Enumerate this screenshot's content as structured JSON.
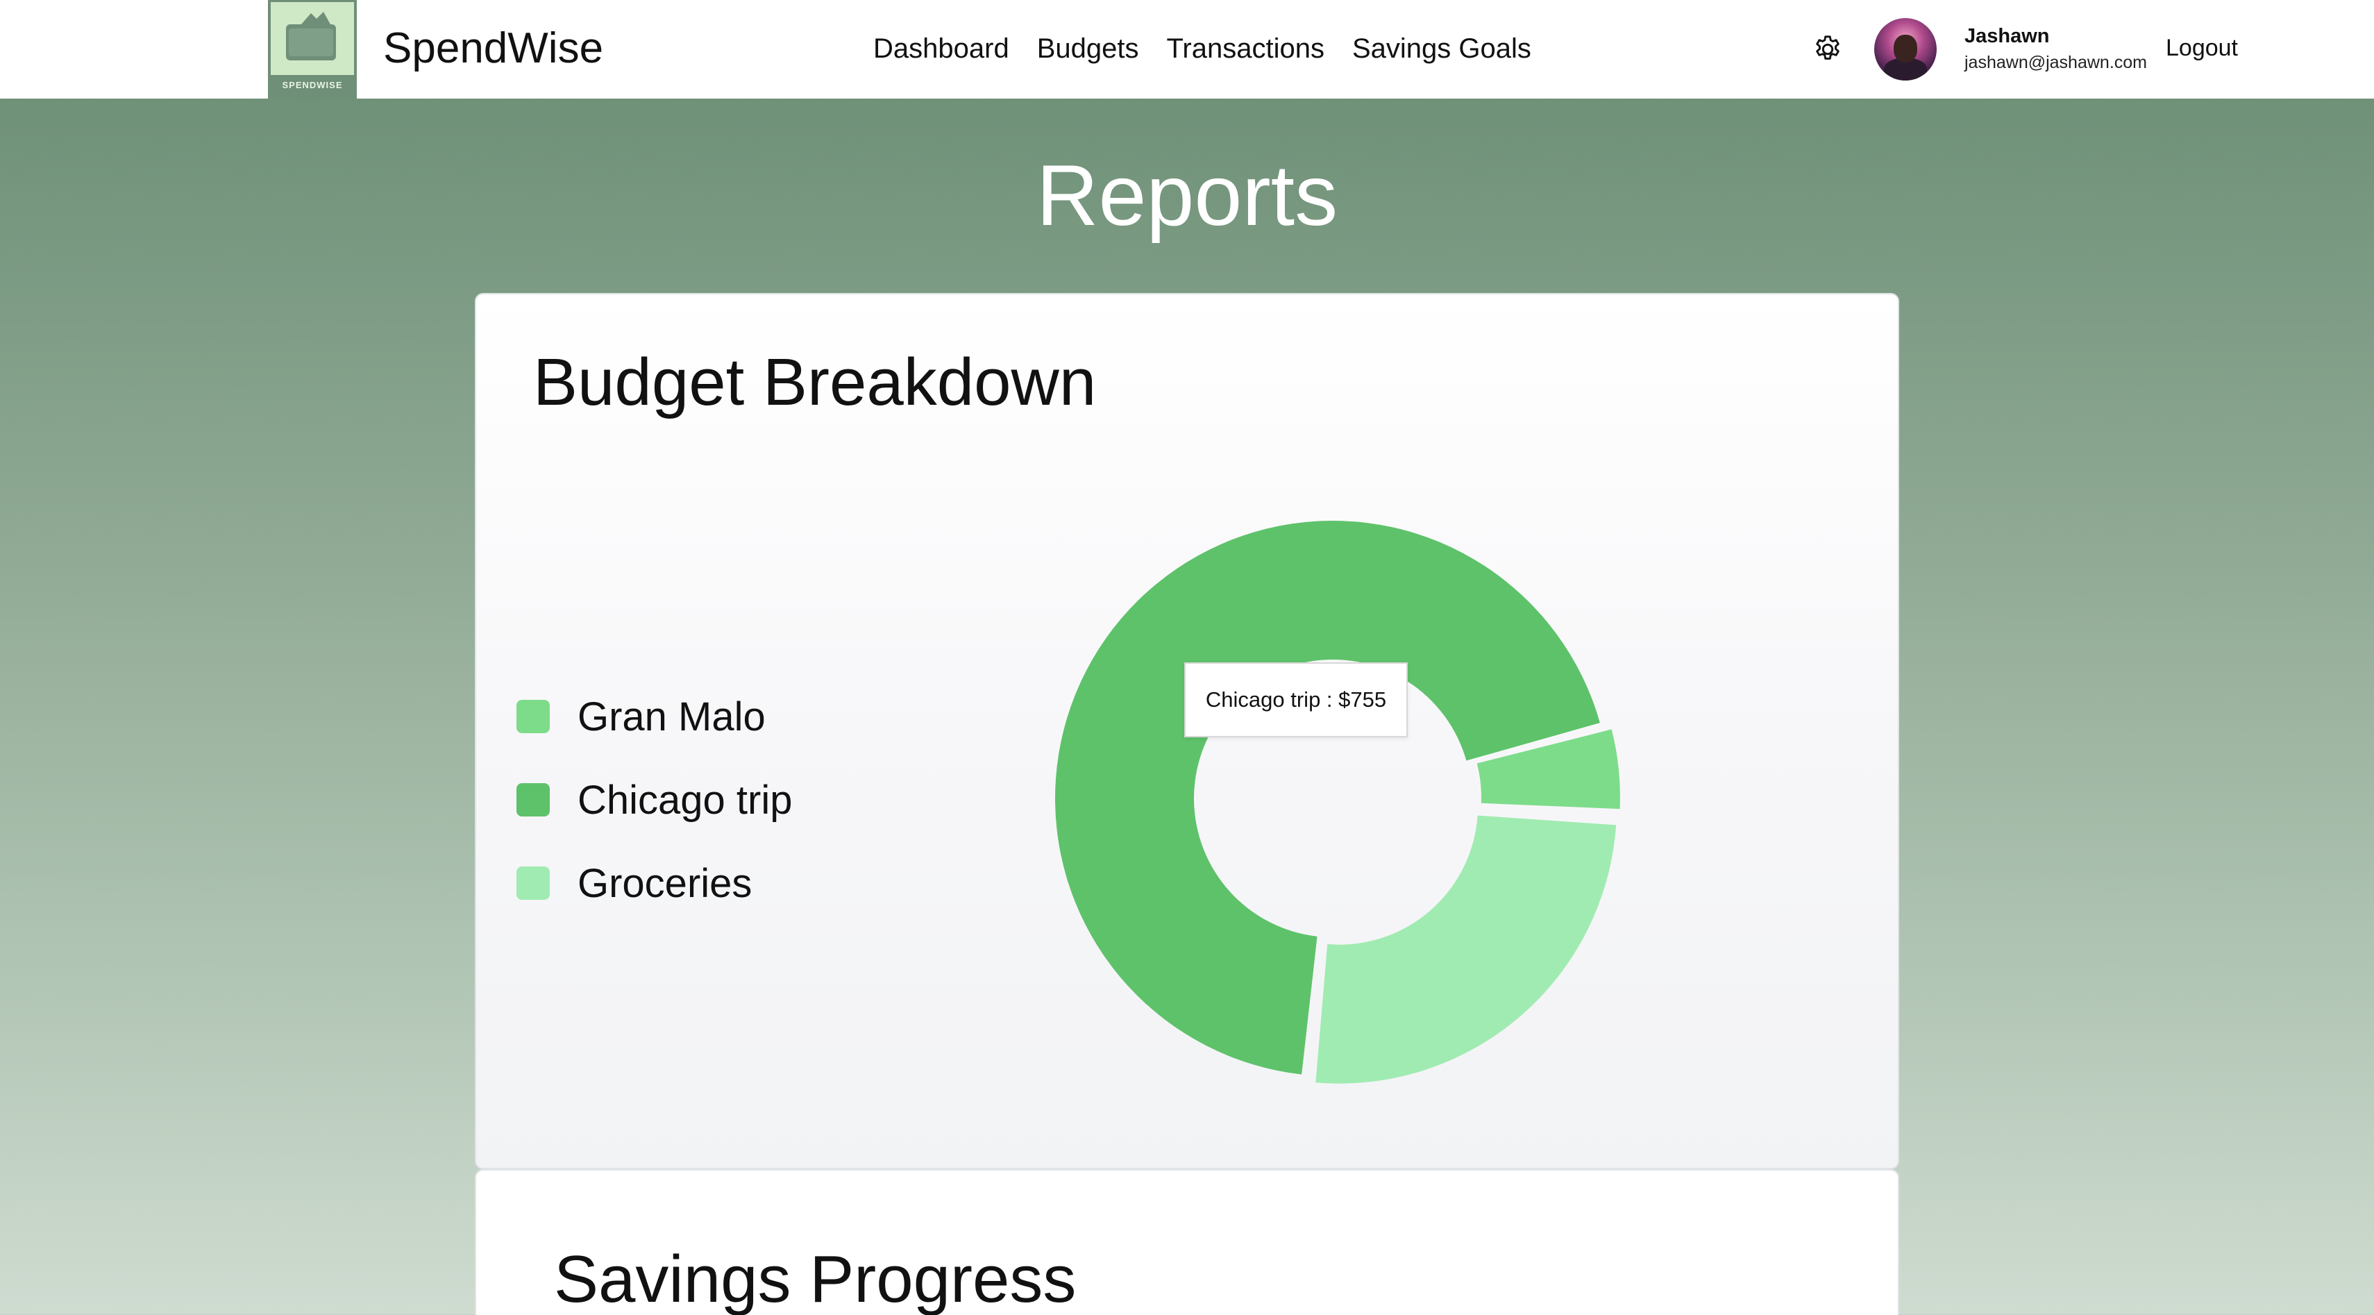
{
  "app": {
    "brand": "SpendWise",
    "logo_text": "SPENDWISE"
  },
  "nav": {
    "links": [
      "Dashboard",
      "Budgets",
      "Transactions",
      "Savings Goals"
    ]
  },
  "user": {
    "name": "Jashawn",
    "email": "jashawn@jashawn.com",
    "logout_label": "Logout",
    "settings_icon": "gear-icon"
  },
  "page": {
    "title": "Reports"
  },
  "budget_card": {
    "title": "Budget Breakdown",
    "tooltip": "Chicago trip : $755"
  },
  "savings_card": {
    "title": "Savings Progress"
  },
  "colors": {
    "accent_dark": "#5ec26a",
    "accent_mid": "#7ddc8a",
    "accent_light": "#a0ebb1",
    "header_green": "#688c72"
  },
  "chart_data": {
    "type": "pie",
    "variant": "doughnut",
    "legend_placement": "left",
    "slices": [
      {
        "name": "Gran Malo",
        "value": 55,
        "color": "#7ddc8a"
      },
      {
        "name": "Chicago trip",
        "value": 755,
        "color": "#5ec26a"
      },
      {
        "name": "Groceries",
        "value": 280,
        "color": "#a0ebb1"
      }
    ],
    "hovered": "Chicago trip"
  }
}
